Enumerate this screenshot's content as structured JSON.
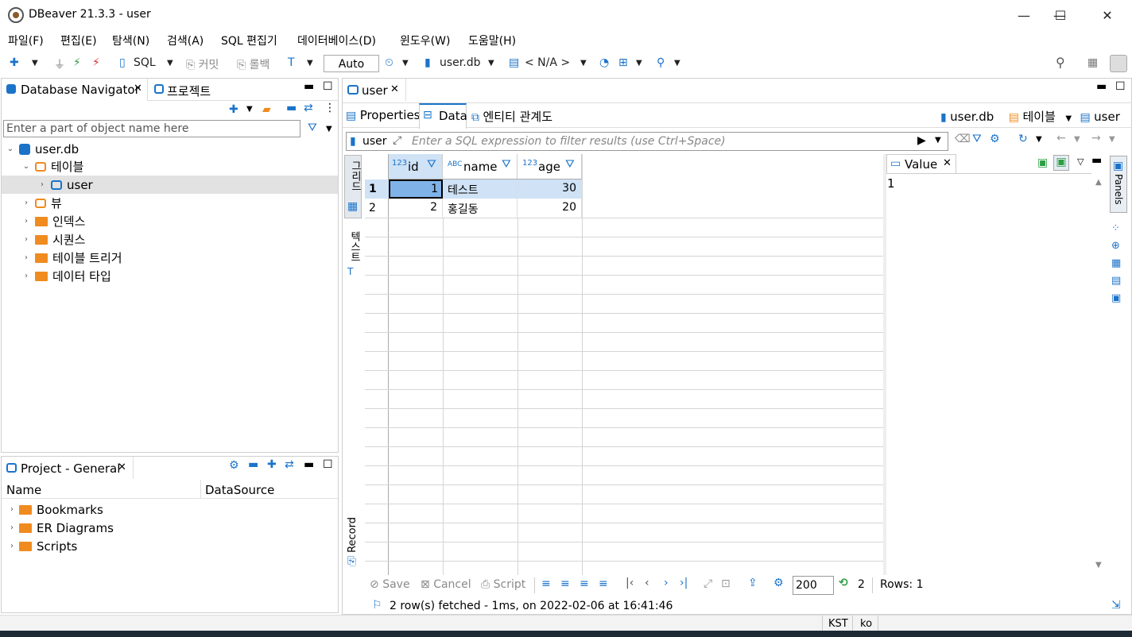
{
  "window": {
    "title": "DBeaver 21.3.3 - user",
    "minimize": "—",
    "maximize": "☐",
    "close": "✕"
  },
  "menu": [
    "파일(F)",
    "편집(E)",
    "탐색(N)",
    "검색(A)",
    "SQL 편집기",
    "데이터베이스(D)",
    "윈도우(W)",
    "도움말(H)"
  ],
  "toolbar": {
    "sql": "SQL",
    "commit": "커밋",
    "rollback": "롤백",
    "mode": "Auto",
    "database": "user.db",
    "schema": "< N/A >"
  },
  "navigator": {
    "tab1": "Database Navigator",
    "tab2": "프로젝트",
    "filter_placeholder": "Enter a part of object name here",
    "root": "user.db",
    "tables_label": "테이블",
    "table_user": "user",
    "views": "뷰",
    "indexes": "인덱스",
    "sequences": "시퀀스",
    "triggers": "테이블 트리거",
    "datatypes": "데이터 타입"
  },
  "project": {
    "tab": "Project - General",
    "col_name": "Name",
    "col_datasource": "DataSource",
    "items": [
      "Bookmarks",
      "ER Diagrams",
      "Scripts"
    ]
  },
  "editor": {
    "tab": "user",
    "subtabs": [
      "Properties",
      "Data",
      "엔티티 관계도"
    ],
    "crumb_db": "user.db",
    "crumb_tables": "테이블",
    "crumb_table": "user",
    "filter_label": "user",
    "filter_placeholder": "Enter a SQL expression to filter results (use Ctrl+Space)",
    "side_grid": "그리드",
    "side_text": "텍스트",
    "side_record": "Record",
    "panels_label": "Panels"
  },
  "grid": {
    "columns": [
      {
        "type": "123",
        "name": "id"
      },
      {
        "type": "ABC",
        "name": "name"
      },
      {
        "type": "123",
        "name": "age"
      }
    ],
    "rows": [
      {
        "num": "1",
        "id": "1",
        "name": "테스트",
        "age": "30"
      },
      {
        "num": "2",
        "id": "2",
        "name": "홍길동",
        "age": "20"
      }
    ]
  },
  "value_panel": {
    "title": "Value",
    "content": "1"
  },
  "bottom": {
    "save": "Save",
    "cancel": "Cancel",
    "script": "Script",
    "fetch_size": "200",
    "count": "2",
    "rows": "Rows: 1",
    "status": "2 row(s) fetched - 1ms, on 2022-02-06 at 16:41:46"
  },
  "statusbar": {
    "tz": "KST",
    "locale": "ko"
  },
  "colors": {
    "accent": "#1a73c9",
    "selection": "#cfe2f6",
    "folder": "#f08b1f",
    "green": "#2e9e44"
  }
}
